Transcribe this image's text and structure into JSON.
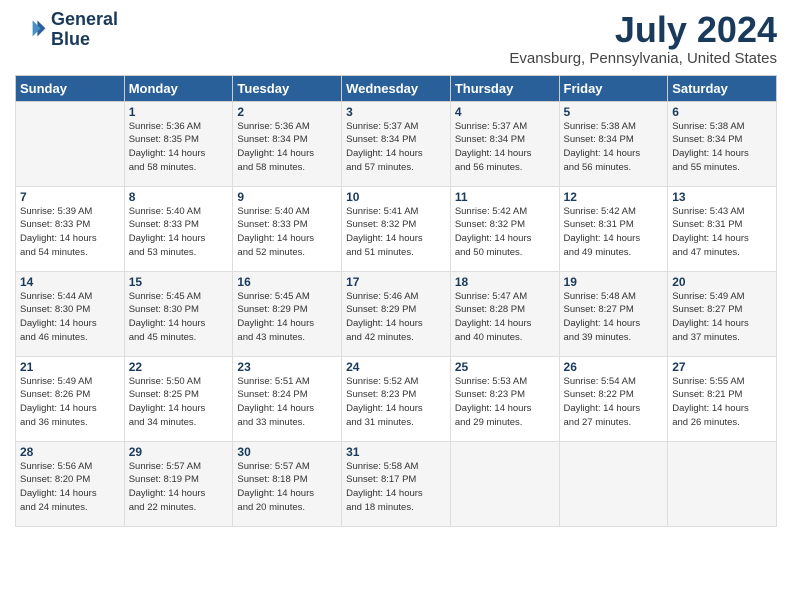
{
  "header": {
    "logo_line1": "General",
    "logo_line2": "Blue",
    "title": "July 2024",
    "subtitle": "Evansburg, Pennsylvania, United States"
  },
  "days_of_week": [
    "Sunday",
    "Monday",
    "Tuesday",
    "Wednesday",
    "Thursday",
    "Friday",
    "Saturday"
  ],
  "weeks": [
    [
      {
        "num": "",
        "info": ""
      },
      {
        "num": "1",
        "info": "Sunrise: 5:36 AM\nSunset: 8:35 PM\nDaylight: 14 hours\nand 58 minutes."
      },
      {
        "num": "2",
        "info": "Sunrise: 5:36 AM\nSunset: 8:34 PM\nDaylight: 14 hours\nand 58 minutes."
      },
      {
        "num": "3",
        "info": "Sunrise: 5:37 AM\nSunset: 8:34 PM\nDaylight: 14 hours\nand 57 minutes."
      },
      {
        "num": "4",
        "info": "Sunrise: 5:37 AM\nSunset: 8:34 PM\nDaylight: 14 hours\nand 56 minutes."
      },
      {
        "num": "5",
        "info": "Sunrise: 5:38 AM\nSunset: 8:34 PM\nDaylight: 14 hours\nand 56 minutes."
      },
      {
        "num": "6",
        "info": "Sunrise: 5:38 AM\nSunset: 8:34 PM\nDaylight: 14 hours\nand 55 minutes."
      }
    ],
    [
      {
        "num": "7",
        "info": "Sunrise: 5:39 AM\nSunset: 8:33 PM\nDaylight: 14 hours\nand 54 minutes."
      },
      {
        "num": "8",
        "info": "Sunrise: 5:40 AM\nSunset: 8:33 PM\nDaylight: 14 hours\nand 53 minutes."
      },
      {
        "num": "9",
        "info": "Sunrise: 5:40 AM\nSunset: 8:33 PM\nDaylight: 14 hours\nand 52 minutes."
      },
      {
        "num": "10",
        "info": "Sunrise: 5:41 AM\nSunset: 8:32 PM\nDaylight: 14 hours\nand 51 minutes."
      },
      {
        "num": "11",
        "info": "Sunrise: 5:42 AM\nSunset: 8:32 PM\nDaylight: 14 hours\nand 50 minutes."
      },
      {
        "num": "12",
        "info": "Sunrise: 5:42 AM\nSunset: 8:31 PM\nDaylight: 14 hours\nand 49 minutes."
      },
      {
        "num": "13",
        "info": "Sunrise: 5:43 AM\nSunset: 8:31 PM\nDaylight: 14 hours\nand 47 minutes."
      }
    ],
    [
      {
        "num": "14",
        "info": "Sunrise: 5:44 AM\nSunset: 8:30 PM\nDaylight: 14 hours\nand 46 minutes."
      },
      {
        "num": "15",
        "info": "Sunrise: 5:45 AM\nSunset: 8:30 PM\nDaylight: 14 hours\nand 45 minutes."
      },
      {
        "num": "16",
        "info": "Sunrise: 5:45 AM\nSunset: 8:29 PM\nDaylight: 14 hours\nand 43 minutes."
      },
      {
        "num": "17",
        "info": "Sunrise: 5:46 AM\nSunset: 8:29 PM\nDaylight: 14 hours\nand 42 minutes."
      },
      {
        "num": "18",
        "info": "Sunrise: 5:47 AM\nSunset: 8:28 PM\nDaylight: 14 hours\nand 40 minutes."
      },
      {
        "num": "19",
        "info": "Sunrise: 5:48 AM\nSunset: 8:27 PM\nDaylight: 14 hours\nand 39 minutes."
      },
      {
        "num": "20",
        "info": "Sunrise: 5:49 AM\nSunset: 8:27 PM\nDaylight: 14 hours\nand 37 minutes."
      }
    ],
    [
      {
        "num": "21",
        "info": "Sunrise: 5:49 AM\nSunset: 8:26 PM\nDaylight: 14 hours\nand 36 minutes."
      },
      {
        "num": "22",
        "info": "Sunrise: 5:50 AM\nSunset: 8:25 PM\nDaylight: 14 hours\nand 34 minutes."
      },
      {
        "num": "23",
        "info": "Sunrise: 5:51 AM\nSunset: 8:24 PM\nDaylight: 14 hours\nand 33 minutes."
      },
      {
        "num": "24",
        "info": "Sunrise: 5:52 AM\nSunset: 8:23 PM\nDaylight: 14 hours\nand 31 minutes."
      },
      {
        "num": "25",
        "info": "Sunrise: 5:53 AM\nSunset: 8:23 PM\nDaylight: 14 hours\nand 29 minutes."
      },
      {
        "num": "26",
        "info": "Sunrise: 5:54 AM\nSunset: 8:22 PM\nDaylight: 14 hours\nand 27 minutes."
      },
      {
        "num": "27",
        "info": "Sunrise: 5:55 AM\nSunset: 8:21 PM\nDaylight: 14 hours\nand 26 minutes."
      }
    ],
    [
      {
        "num": "28",
        "info": "Sunrise: 5:56 AM\nSunset: 8:20 PM\nDaylight: 14 hours\nand 24 minutes."
      },
      {
        "num": "29",
        "info": "Sunrise: 5:57 AM\nSunset: 8:19 PM\nDaylight: 14 hours\nand 22 minutes."
      },
      {
        "num": "30",
        "info": "Sunrise: 5:57 AM\nSunset: 8:18 PM\nDaylight: 14 hours\nand 20 minutes."
      },
      {
        "num": "31",
        "info": "Sunrise: 5:58 AM\nSunset: 8:17 PM\nDaylight: 14 hours\nand 18 minutes."
      },
      {
        "num": "",
        "info": ""
      },
      {
        "num": "",
        "info": ""
      },
      {
        "num": "",
        "info": ""
      }
    ]
  ]
}
